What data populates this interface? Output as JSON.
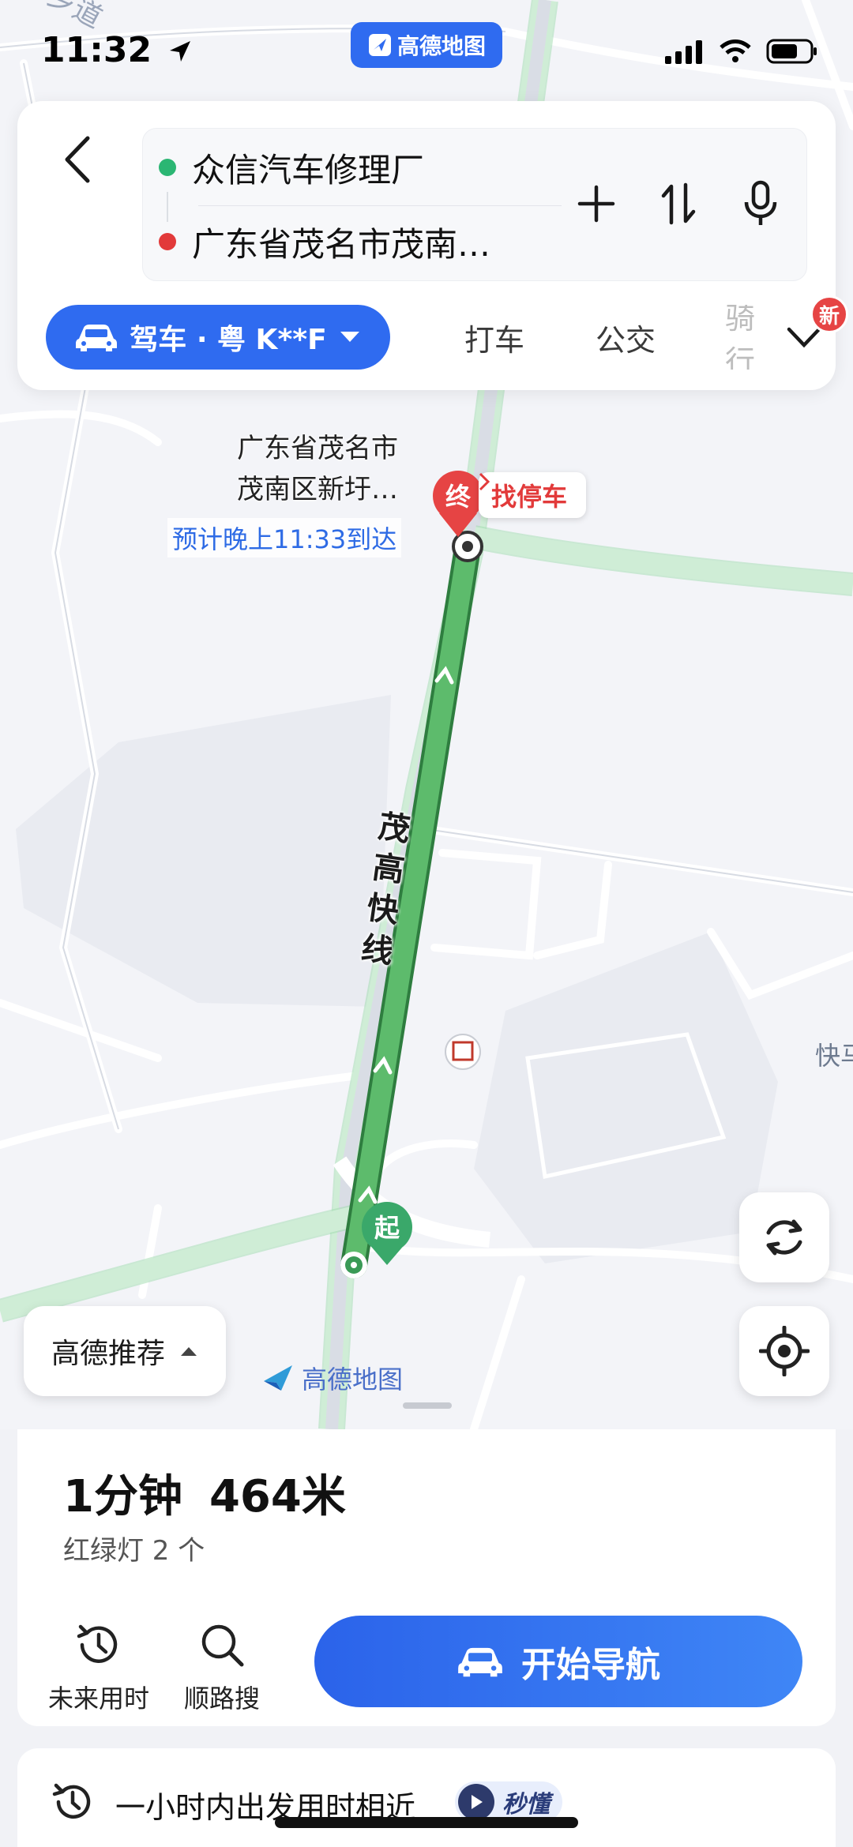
{
  "status_bar": {
    "time": "11:32",
    "app_pill": "高德地图"
  },
  "route": {
    "start": "众信汽车修理厂",
    "end": "广东省茂名市茂南…",
    "start_color": "#2bb673",
    "end_color": "#e23a3a"
  },
  "modes": {
    "active": "驾车 · 粤 K**F",
    "taxi": "打车",
    "bus": "公交",
    "ride": "骑行",
    "new_badge": "新"
  },
  "map": {
    "dest_name_line1": "广东省茂名市",
    "dest_name_line2": "茂南区新圩…",
    "eta": "预计晚上11:33到达",
    "find_parking": "找停车",
    "end_marker": "终",
    "start_marker": "起",
    "road_name": "茂高快线",
    "road_fast": "快马",
    "village_road": "乡道",
    "watermark": "高德地图",
    "route_color": "#5dbb6c"
  },
  "controls": {
    "recommend": "高德推荐"
  },
  "summary": {
    "duration": "1分钟",
    "distance": "464米",
    "lights": "红绿灯 2 个"
  },
  "tools": {
    "future_time": "未来用时",
    "along_search": "顺路搜"
  },
  "start_nav": "开始导航",
  "tip": {
    "text": "一小时内出发用时相近",
    "tag": "秒懂"
  },
  "accent": "#2f6bf0"
}
